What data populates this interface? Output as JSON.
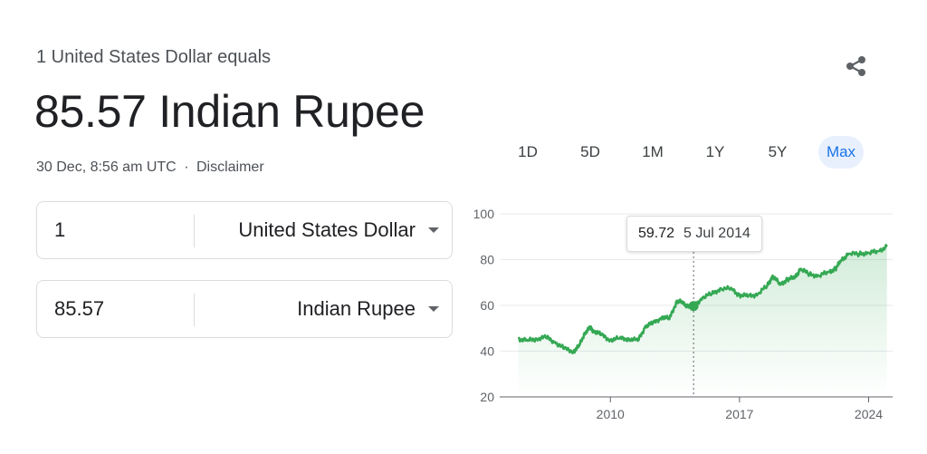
{
  "header": {
    "subtitle": "1 United States Dollar equals",
    "value": "85.57 Indian Rupee",
    "timestamp": "30 Dec, 8:56 am UTC",
    "separator": "·",
    "disclaimer": "Disclaimer"
  },
  "share": {
    "icon": "share-icon"
  },
  "converter": {
    "from": {
      "amount": "1",
      "currency": "United States Dollar"
    },
    "to": {
      "amount": "85.57",
      "currency": "Indian Rupee"
    }
  },
  "ranges": {
    "items": [
      "1D",
      "5D",
      "1M",
      "1Y",
      "5Y",
      "Max"
    ],
    "selected": "Max"
  },
  "tooltip": {
    "value": "59.72",
    "date": "5 Jul 2014"
  },
  "colors": {
    "line": "#34a853",
    "accent": "#1a73e8",
    "text": "#202124",
    "muted": "#5f6368"
  },
  "chart_data": {
    "type": "area",
    "y_ticks": [
      100,
      80,
      60,
      40,
      20
    ],
    "x_ticks": [
      "2010",
      "2017",
      "2024"
    ],
    "ylim": [
      20,
      100
    ],
    "xlim": [
      2004.0,
      2025.3
    ],
    "x": [
      2005.0,
      2005.5,
      2006.0,
      2006.5,
      2007.0,
      2007.5,
      2008.0,
      2008.3,
      2008.6,
      2008.9,
      2009.1,
      2009.5,
      2010.0,
      2010.5,
      2011.0,
      2011.5,
      2011.9,
      2012.3,
      2012.8,
      2013.2,
      2013.6,
      2013.9,
      2014.2,
      2014.51,
      2015.0,
      2015.5,
      2016.0,
      2016.6,
      2017.0,
      2017.5,
      2018.0,
      2018.5,
      2018.8,
      2019.2,
      2019.6,
      2020.0,
      2020.3,
      2020.8,
      2021.3,
      2021.8,
      2022.2,
      2022.5,
      2022.9,
      2023.5,
      2024.0,
      2024.5,
      2024.99
    ],
    "y": [
      45.5,
      44.5,
      45.5,
      46.0,
      44.0,
      41.0,
      40.0,
      42.0,
      48.0,
      50.0,
      49.0,
      47.0,
      45.0,
      45.5,
      45.5,
      44.5,
      51.0,
      52.0,
      55.0,
      54.0,
      62.0,
      61.0,
      60.0,
      59.72,
      63.5,
      65.0,
      67.5,
      67.0,
      64.5,
      64.0,
      65.0,
      68.5,
      73.0,
      69.0,
      71.5,
      72.0,
      76.0,
      73.5,
      73.0,
      74.5,
      76.0,
      79.5,
      82.5,
      82.5,
      83.0,
      83.7,
      85.57
    ],
    "highlight": {
      "x": 2014.51,
      "y": 59.72
    }
  }
}
